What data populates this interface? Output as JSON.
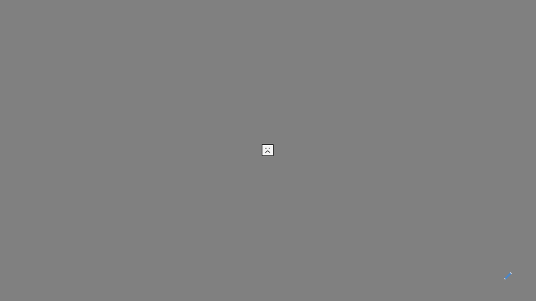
{
  "colors": {
    "background": "#808080",
    "icon_border": "#222222",
    "icon_fill": "#f2f2f2",
    "accent": "#4a86c8"
  },
  "icons": {
    "broken_image": "sad-face-broken-image-icon",
    "edit": "pencil-edit-icon"
  }
}
